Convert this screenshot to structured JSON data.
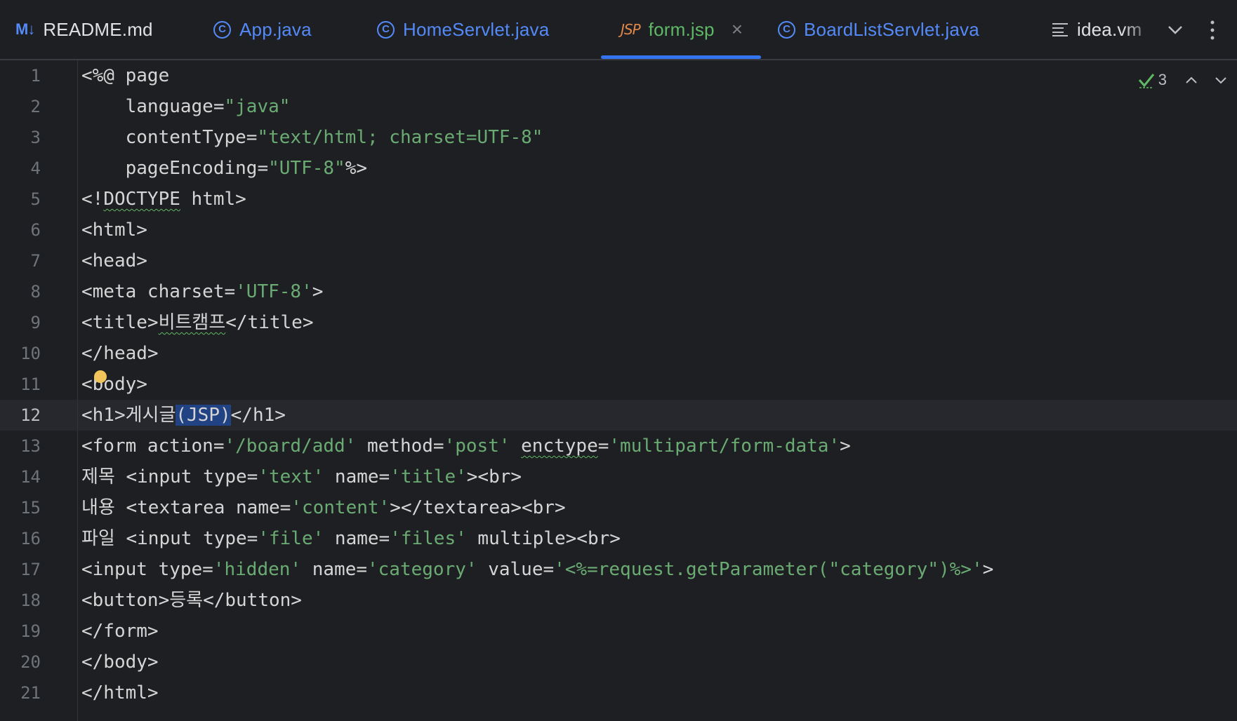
{
  "tabs": [
    {
      "label": "README.md",
      "icon": "markdown-icon",
      "icon_text": "M↓"
    },
    {
      "label": "App.java",
      "icon": "java-class-icon",
      "icon_text": "C"
    },
    {
      "label": "HomeServlet.java",
      "icon": "java-class-icon",
      "icon_text": "C"
    },
    {
      "label": "form.jsp",
      "icon": "jsp-icon",
      "icon_text": "JSP",
      "active": true,
      "close": "×"
    },
    {
      "label": "BoardListServlet.java",
      "icon": "java-class-icon",
      "icon_text": "C"
    },
    {
      "label": "idea.vm",
      "icon": "text-file-icon"
    }
  ],
  "inspections": {
    "count": "3"
  },
  "editor": {
    "current_line": 12,
    "line_numbers": [
      "1",
      "2",
      "3",
      "4",
      "5",
      "6",
      "7",
      "8",
      "9",
      "10",
      "11",
      "12",
      "13",
      "14",
      "15",
      "16",
      "17",
      "18",
      "19",
      "20",
      "21"
    ],
    "code": {
      "l1": "<%@ page",
      "l2a": "    language=",
      "l2b": "\"java\"",
      "l3a": "    contentType=",
      "l3b": "\"text/html; charset=UTF-8\"",
      "l4a": "    pageEncoding=",
      "l4b": "\"UTF-8\"",
      "l4c": "%>",
      "l5a": "<!",
      "l5b": "DOCTYPE",
      "l5c": " html>",
      "l6": "<html>",
      "l7": "<head>",
      "l8a": "<meta charset=",
      "l8b": "'UTF-8'",
      "l8c": ">",
      "l9a": "<title>",
      "l9b": "비트캠프",
      "l9c": "</title>",
      "l10": "</head>",
      "l11": "<body>",
      "l12a": "<h1>게시글",
      "l12b": "(JSP)",
      "l12c": "</h1>",
      "l13a": "<form action=",
      "l13b": "'/board/add'",
      "l13c": " method=",
      "l13d": "'post'",
      "l13e": " ",
      "l13f": "enctype",
      "l13g": "=",
      "l13h": "'multipart/form-data'",
      "l13i": ">",
      "l14a": "제목 <input type=",
      "l14b": "'text'",
      "l14c": " name=",
      "l14d": "'title'",
      "l14e": "><br>",
      "l15a": "내용 <textarea name=",
      "l15b": "'content'",
      "l15c": "></textarea><br>",
      "l16a": "파일 <input type=",
      "l16b": "'file'",
      "l16c": " name=",
      "l16d": "'files'",
      "l16e": " multiple><br>",
      "l17a": "<input type=",
      "l17b": "'hidden'",
      "l17c": " name=",
      "l17d": "'category'",
      "l17e": " value=",
      "l17f": "'<%=request.getParameter(\"category\")%>'",
      "l17g": ">",
      "l18": "<button>등록</button>",
      "l19": "</form>",
      "l20": "</body>",
      "l21": "</html>"
    }
  },
  "colors": {
    "background": "#1e1f22",
    "string": "#6aab73",
    "tab_link": "#548af7",
    "active_tab": "#5fb865",
    "active_underline": "#3574f0",
    "selection": "#214283",
    "bulb": "#f2c55c"
  }
}
